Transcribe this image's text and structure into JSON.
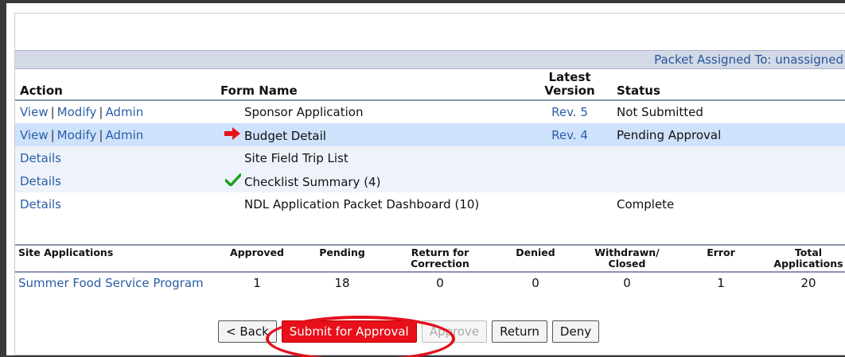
{
  "assigned": {
    "label": "Packet Assigned To:",
    "value": "unassigned"
  },
  "forms": {
    "headers": {
      "action": "Action",
      "form_name": "Form Name",
      "latest": "Latest",
      "version": "Version",
      "status": "Status"
    },
    "rows": [
      {
        "links": [
          "View",
          "Modify",
          "Admin"
        ],
        "name": "Sponsor Application",
        "version": "Rev. 5",
        "status": "Not Submitted",
        "icon": ""
      },
      {
        "links": [
          "View",
          "Modify",
          "Admin"
        ],
        "name": "Budget Detail",
        "version": "Rev. 4",
        "status": "Pending Approval",
        "icon": "red-arrow-icon"
      },
      {
        "links": [
          "Details"
        ],
        "name": "Site Field Trip List",
        "version": "",
        "status": "",
        "icon": ""
      },
      {
        "links": [
          "Details"
        ],
        "name": "Checklist Summary (4)",
        "version": "",
        "status": "",
        "icon": "green-check-icon"
      },
      {
        "links": [
          "Details"
        ],
        "name": "NDL Application Packet Dashboard (10)",
        "version": "",
        "status": "Complete",
        "icon": ""
      }
    ]
  },
  "sites": {
    "headers": [
      "Site Applications",
      "Approved",
      "Pending",
      "Return for Correction",
      "Denied",
      "Withdrawn/ Closed",
      "Error",
      "Total Applications"
    ],
    "rows": [
      {
        "name": "Summer Food Service Program",
        "values": [
          "1",
          "18",
          "0",
          "0",
          "0",
          "1",
          "20"
        ]
      }
    ]
  },
  "buttons": {
    "back": "< Back",
    "submit": "Submit for Approval",
    "approve": "Approve",
    "return": "Return",
    "deny": "Deny"
  },
  "colors": {
    "accent_red": "#e8101a",
    "link_blue": "#2a5ea6",
    "highlight_row": "#cfe2fb"
  }
}
